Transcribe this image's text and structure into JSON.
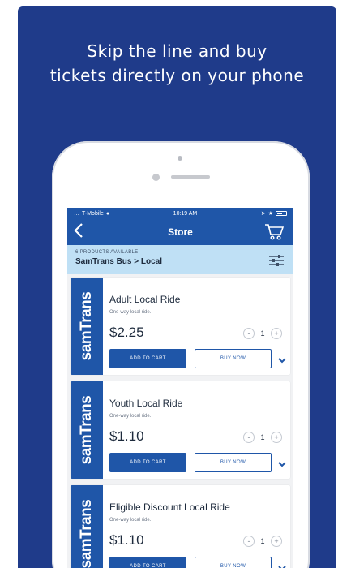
{
  "headline": {
    "line1": "Skip the line and buy",
    "line2": "tickets directly on your phone"
  },
  "status_bar": {
    "carrier": "T-Mobile",
    "time": "10:19 AM"
  },
  "nav": {
    "title": "Store",
    "back_icon": "chevron-left-icon",
    "cart_icon": "cart-icon"
  },
  "store": {
    "products_count_label": "6 PRODUCTS AVAILABLE",
    "breadcrumb": "SamTrans Bus > Local",
    "filter_icon": "filter-icon"
  },
  "products": [
    {
      "brand": "samTrans",
      "name": "Adult Local Ride",
      "description": "One-way local ride.",
      "price": "$2.25",
      "quantity": "1",
      "minus": "-",
      "plus": "+",
      "add_to_cart": "ADD TO CART",
      "buy_now": "BUY NOW"
    },
    {
      "brand": "samTrans",
      "name": "Youth Local Ride",
      "description": "One-way local ride.",
      "price": "$1.10",
      "quantity": "1",
      "minus": "-",
      "plus": "+",
      "add_to_cart": "ADD TO CART",
      "buy_now": "BUY NOW"
    },
    {
      "brand": "samTrans",
      "name": "Eligible Discount Local Ride",
      "description": "One-way local ride.",
      "price": "$1.10",
      "quantity": "1",
      "minus": "-",
      "plus": "+",
      "add_to_cart": "ADD TO CART",
      "buy_now": "BUY NOW"
    }
  ],
  "colors": {
    "poster_background": "#1f3b8a",
    "app_blue": "#1f56a8",
    "subheader_background": "#bfe0f5"
  }
}
